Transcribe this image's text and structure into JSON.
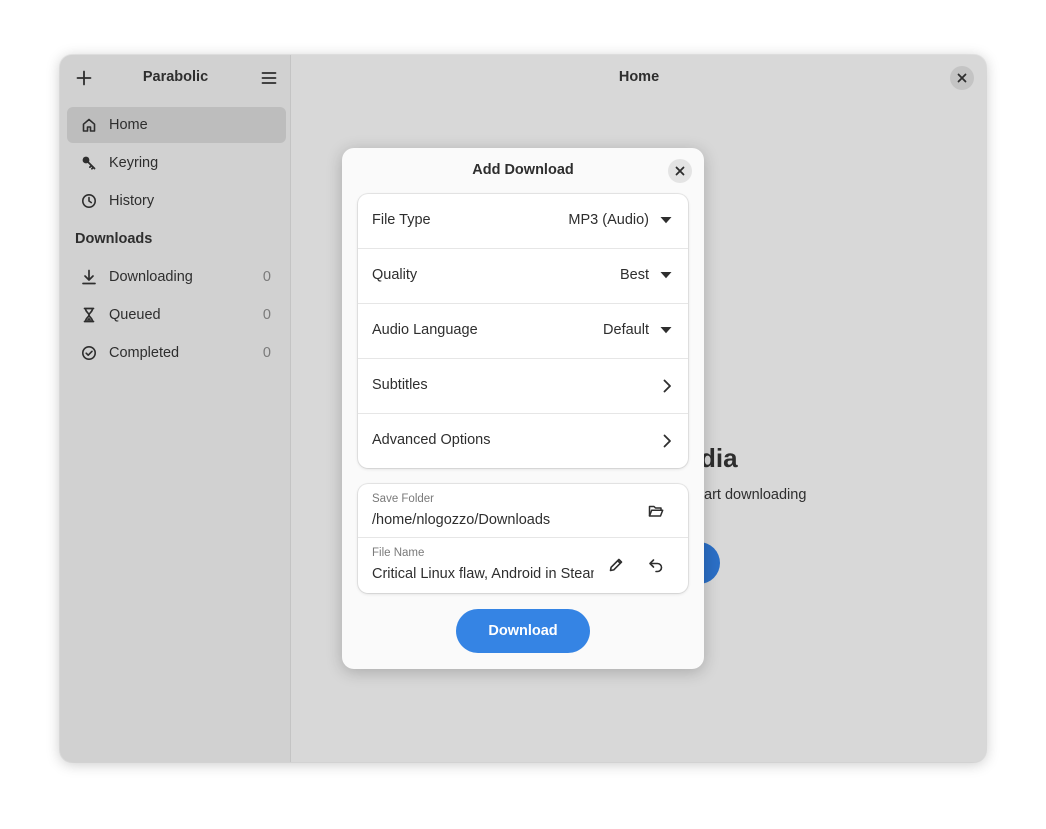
{
  "sidebar": {
    "title": "Parabolic",
    "add_icon": "plus-icon",
    "menu_icon": "hamburger-menu-icon",
    "items": [
      {
        "label": "Home",
        "icon": "home-icon"
      },
      {
        "label": "Keyring",
        "icon": "key-icon"
      },
      {
        "label": "History",
        "icon": "clock-icon"
      }
    ],
    "downloads_section": "Downloads",
    "downloads": [
      {
        "label": "Downloading",
        "count": "0",
        "icon": "download-arrow-icon"
      },
      {
        "label": "Queued",
        "count": "0",
        "icon": "hourglass-icon"
      },
      {
        "label": "Completed",
        "count": "0",
        "icon": "check-circle-icon"
      }
    ]
  },
  "content": {
    "title": "Home",
    "status_title": "dia",
    "status_desc": "tart downloading"
  },
  "dialog": {
    "title": "Add Download",
    "rows": [
      {
        "label": "File Type",
        "value": "MP3 (Audio)"
      },
      {
        "label": "Quality",
        "value": "Best"
      },
      {
        "label": "Audio Language",
        "value": "Default"
      },
      {
        "label": "Subtitles"
      },
      {
        "label": "Advanced Options"
      }
    ],
    "save_folder": {
      "caption": "Save Folder",
      "value": "/home/nlogozzo/Downloads"
    },
    "file_name": {
      "caption": "File Name",
      "value": "Critical Linux flaw, Android in Steam"
    },
    "download_button": "Download"
  },
  "colors": {
    "accent": "#3584e4",
    "sidebar_bg": "#d1d1d1",
    "content_bg": "#d8d8d8",
    "dialog_bg": "#fafafa"
  }
}
